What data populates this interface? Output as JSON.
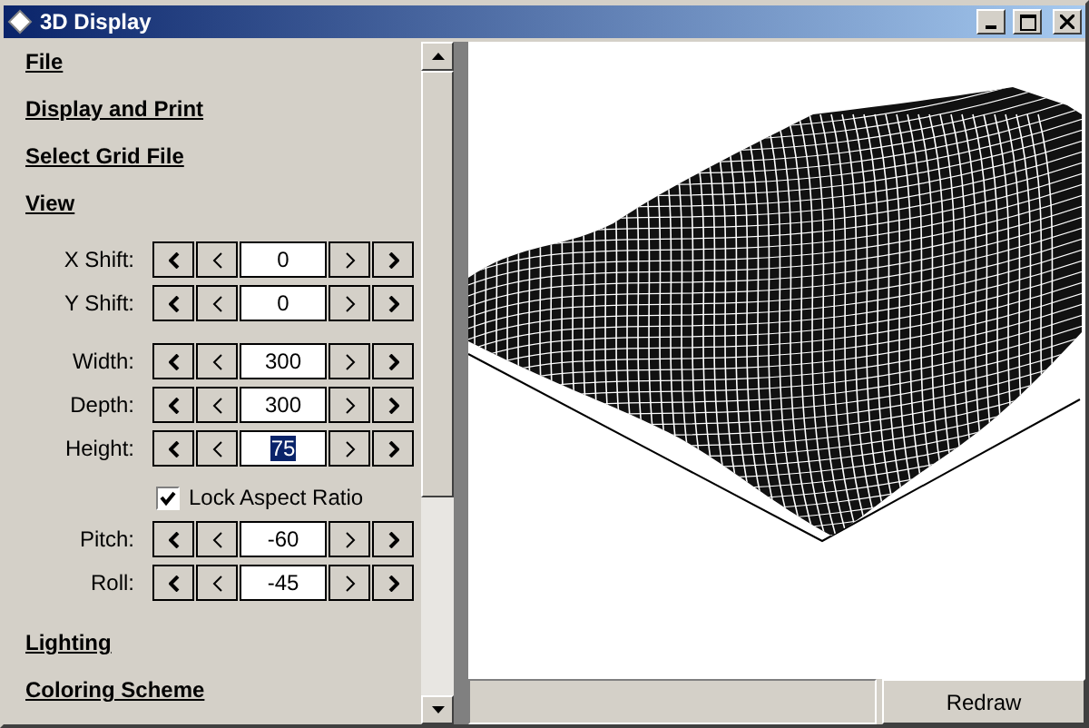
{
  "window": {
    "title": "3D Display"
  },
  "sections_top": [
    "File",
    "Display and Print",
    "Select Grid File",
    "View"
  ],
  "view_groups": [
    {
      "controls": [
        {
          "kind": "spin",
          "label": "X Shift:",
          "value": "0",
          "highlighted": false
        },
        {
          "kind": "spin",
          "label": "Y Shift:",
          "value": "0",
          "highlighted": false
        }
      ]
    },
    {
      "controls": [
        {
          "kind": "spin",
          "label": "Width:",
          "value": "300",
          "highlighted": false
        },
        {
          "kind": "spin",
          "label": "Depth:",
          "value": "300",
          "highlighted": false
        },
        {
          "kind": "spin",
          "label": "Height:",
          "value": "75",
          "highlighted": true
        },
        {
          "kind": "check",
          "label": "Lock Aspect Ratio",
          "checked": true
        },
        {
          "kind": "spin",
          "label": "Pitch:",
          "value": "-60",
          "highlighted": false
        },
        {
          "kind": "spin",
          "label": "Roll:",
          "value": "-45",
          "highlighted": false
        }
      ]
    }
  ],
  "sections_bottom": [
    "Lighting",
    "Coloring Scheme"
  ],
  "redraw_button": "Redraw"
}
